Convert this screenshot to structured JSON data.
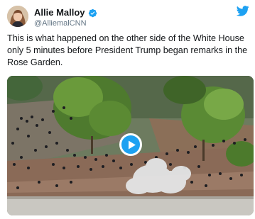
{
  "tweet": {
    "author": {
      "display_name": "Allie Malloy",
      "handle": "@AlliemalCNN",
      "verified": true,
      "avatar_icon": "profile-photo"
    },
    "text": "This is what happened on the other side of the White House only 5 minutes before President Trump began remarks in the Rose Garden.",
    "media": {
      "type": "video",
      "play_icon": "play-icon"
    },
    "brand_icon": "twitter-bird-icon"
  },
  "colors": {
    "brand": "#1da1f2",
    "text": "#14171a",
    "secondary_text": "#657786"
  }
}
